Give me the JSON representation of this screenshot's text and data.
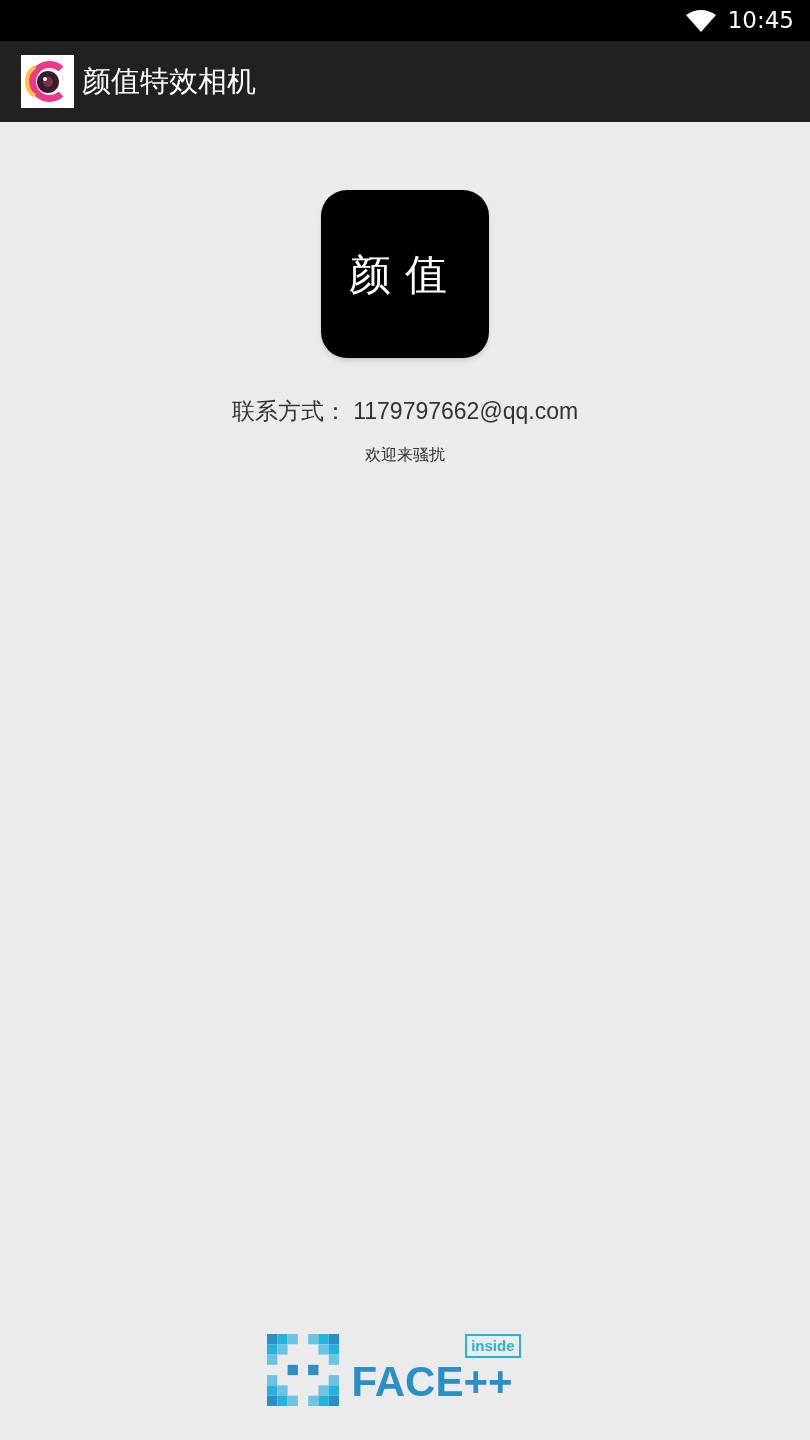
{
  "status_bar": {
    "time": "10:45"
  },
  "app_bar": {
    "title": "颜值特效相机"
  },
  "app_logo": {
    "text": "颜值"
  },
  "contact": {
    "text": "联系方式： 1179797662@qq.com"
  },
  "welcome": {
    "text": "欢迎来骚扰"
  },
  "footer_logo": {
    "brand": "FACE++",
    "badge": "inside"
  }
}
